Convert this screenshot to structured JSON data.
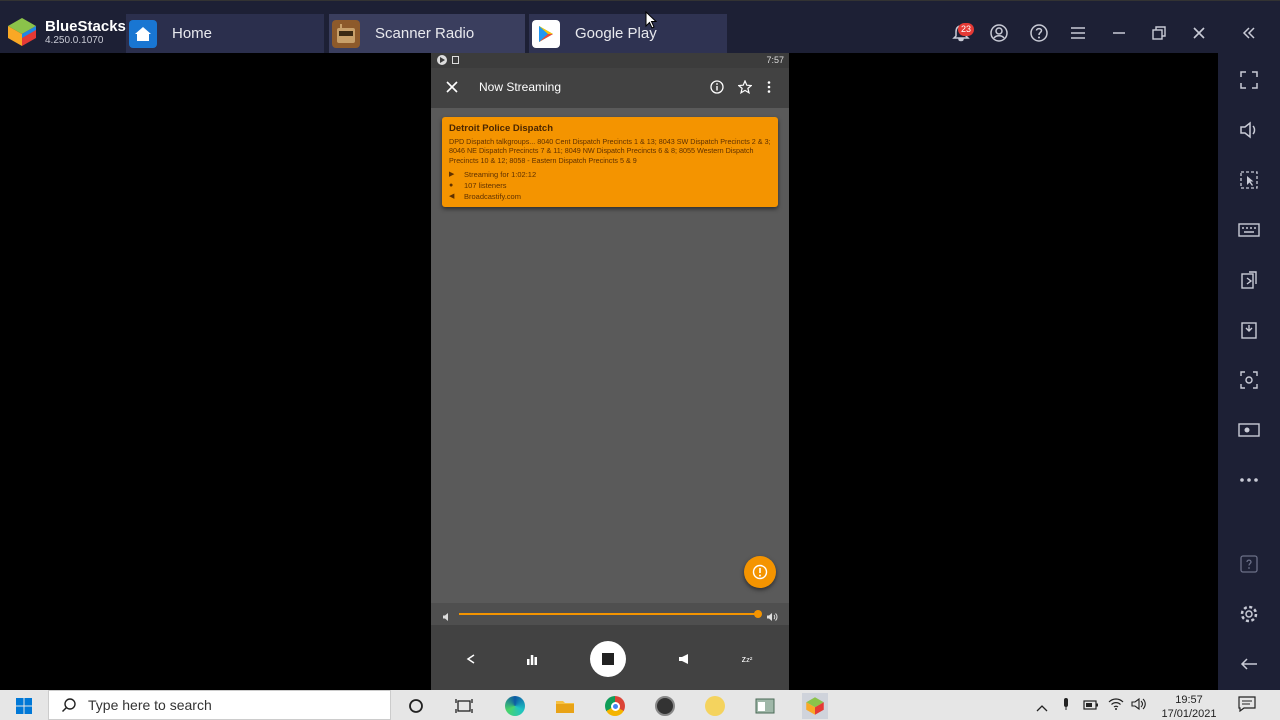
{
  "app": {
    "name": "BlueStacks",
    "version": "4.250.0.1070"
  },
  "tabs": [
    {
      "label": "Home"
    },
    {
      "label": "Scanner Radio"
    },
    {
      "label": "Google Play"
    }
  ],
  "topbar": {
    "notification_count": "23"
  },
  "phone": {
    "status_time": "7:57",
    "appbar_title": "Now Streaming",
    "feed": {
      "title": "Detroit Police Dispatch",
      "description": "DPD Dispatch talkgroups... 8040 Cent Dispatch Precincts 1 & 13; 8043 SW Dispatch Precincts 2 & 3; 8046 NE Dispatch Precincts 7 & 11; 8049 NW Dispatch Precincts 6 & 8; 8055 Western Dispatch Precincts 10 & 12; 8058 - Eastern Dispatch Precincts 5 & 9",
      "streaming": "Streaming for 1:02:12",
      "listeners": "107 listeners",
      "source": "Broadcastify.com"
    },
    "volume_level": 0.99
  },
  "taskbar": {
    "search_placeholder": "Type here to search",
    "time": "19:57",
    "date": "17/01/2021"
  },
  "colors": {
    "accent": "#f49400",
    "chrome": "#1d2035"
  }
}
